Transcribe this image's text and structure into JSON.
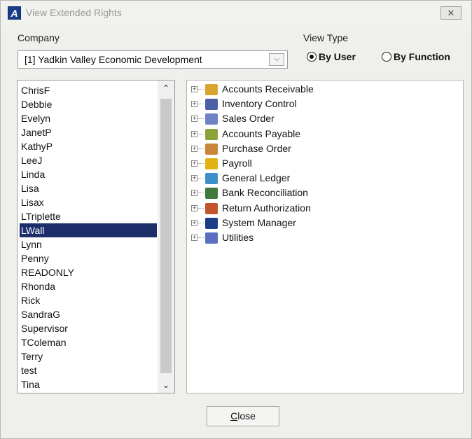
{
  "window": {
    "title": "View Extended Rights",
    "app_icon_letter": "A"
  },
  "company": {
    "label": "Company",
    "selected": "[1]   Yadkin Valley Economic Development"
  },
  "view_type": {
    "label": "View Type",
    "options": [
      {
        "label": "By User",
        "selected": true
      },
      {
        "label": "By Function",
        "selected": false
      }
    ]
  },
  "users": {
    "items": [
      "ChrisF",
      "Debbie",
      "Evelyn",
      "JanetP",
      "KathyP",
      "LeeJ",
      "Linda",
      "Lisa",
      "Lisax",
      "LTriplette",
      "LWall",
      "Lynn",
      "Penny",
      "READONLY",
      "Rhonda",
      "Rick",
      "SandraG",
      "Supervisor",
      "TColeman",
      "Terry",
      "test",
      "Tina"
    ],
    "selected": "LWall"
  },
  "modules": [
    {
      "label": "Accounts Receivable",
      "icon": "accounts-receivable-icon",
      "color": "#d9a531"
    },
    {
      "label": "Inventory Control",
      "icon": "inventory-control-icon",
      "color": "#4b5fa8"
    },
    {
      "label": "Sales Order",
      "icon": "sales-order-icon",
      "color": "#6f83c4"
    },
    {
      "label": "Accounts Payable",
      "icon": "accounts-payable-icon",
      "color": "#8aa33b"
    },
    {
      "label": "Purchase Order",
      "icon": "purchase-order-icon",
      "color": "#c9863a"
    },
    {
      "label": "Payroll",
      "icon": "payroll-icon",
      "color": "#e0b214"
    },
    {
      "label": "General Ledger",
      "icon": "general-ledger-icon",
      "color": "#3d8fc9"
    },
    {
      "label": "Bank Reconciliation",
      "icon": "bank-reconciliation-icon",
      "color": "#3f7a3a"
    },
    {
      "label": "Return Authorization",
      "icon": "return-authorization-icon",
      "color": "#c2542d"
    },
    {
      "label": "System Manager",
      "icon": "system-manager-icon",
      "color": "#1a3d8a"
    },
    {
      "label": "Utilities",
      "icon": "utilities-icon",
      "color": "#5a6fbf"
    }
  ],
  "footer": {
    "close_label_underlined": "C",
    "close_label_rest": "lose"
  }
}
